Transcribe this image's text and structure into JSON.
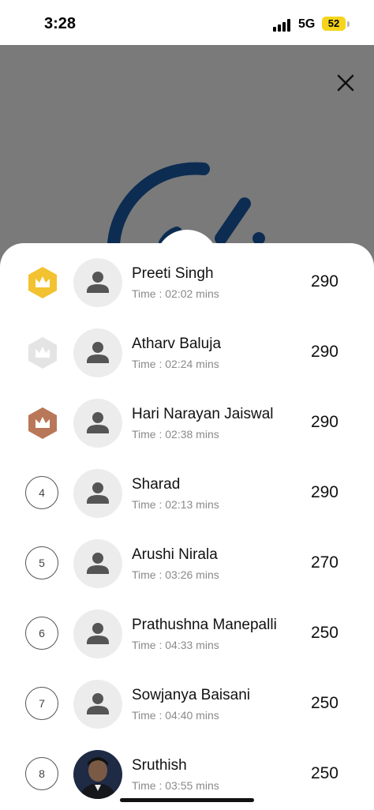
{
  "status_bar": {
    "time": "3:28",
    "network": "5G",
    "battery": "52"
  },
  "colors": {
    "gold": "#f2c230",
    "silver": "#e4e4e4",
    "bronze": "#b9775a",
    "overlay": "#7a7a7a",
    "timer_accent": "#0d2c52"
  },
  "icons": {
    "close": "close-icon",
    "person": "person-icon",
    "crown": "crown-icon"
  },
  "leaderboard": [
    {
      "rank": "1",
      "badge": "gold",
      "name": "Preeti Singh",
      "time": "Time : 02:02 mins",
      "score": "290"
    },
    {
      "rank": "2",
      "badge": "silver",
      "name": "Atharv Baluja",
      "time": "Time : 02:24 mins",
      "score": "290"
    },
    {
      "rank": "3",
      "badge": "bronze",
      "name": "Hari Narayan Jaiswal",
      "time": "Time : 02:38 mins",
      "score": "290"
    },
    {
      "rank": "4",
      "badge": "circle",
      "name": "Sharad",
      "time": "Time : 02:13 mins",
      "score": "290"
    },
    {
      "rank": "5",
      "badge": "circle",
      "name": "Arushi Nirala",
      "time": "Time : 03:26 mins",
      "score": "270"
    },
    {
      "rank": "6",
      "badge": "circle",
      "name": "Prathushna Manepalli",
      "time": "Time : 04:33 mins",
      "score": "250"
    },
    {
      "rank": "7",
      "badge": "circle",
      "name": "Sowjanya Baisani",
      "time": "Time : 04:40 mins",
      "score": "250"
    },
    {
      "rank": "8",
      "badge": "circle",
      "name": "Sruthish",
      "time": "Time : 03:55 mins",
      "score": "250",
      "photo": true
    }
  ]
}
